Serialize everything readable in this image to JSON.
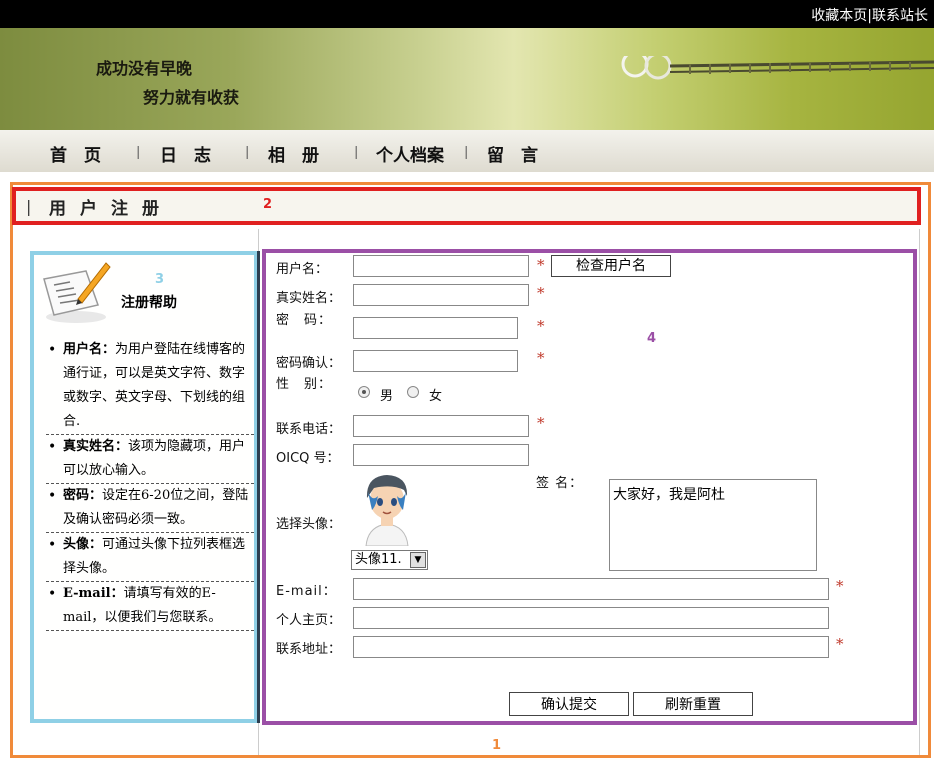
{
  "top_links": {
    "bookmark": "收藏本页",
    "divider": "|",
    "contact": "联系站长"
  },
  "banner": {
    "slogan_line1": "成功没有早晚",
    "slogan_line2": "努力就有收获"
  },
  "nav": {
    "items": [
      "首　页",
      "日　志",
      "相　册",
      "个人档案",
      "留　言"
    ],
    "separator": "|"
  },
  "section": {
    "bar": "|",
    "title": "用户注册"
  },
  "region_numbers": {
    "outer": "1",
    "header": "2",
    "help": "3",
    "form": "4"
  },
  "help": {
    "title": "注册帮助",
    "items": [
      {
        "term": "用户名：",
        "text": "为用户登陆在线博客的通行证，可以是英文字符、数字或数字、英文字母、下划线的组合."
      },
      {
        "term": "真实姓名：",
        "text": "该项为隐藏项，用户可以放心输入。"
      },
      {
        "term": "密码：",
        "text": "设定在6-20位之间，登陆及确认密码必须一致。"
      },
      {
        "term": "头像：",
        "text": "可通过头像下拉列表框选择头像。"
      },
      {
        "term": "E-mail：",
        "text": "请填写有效的E-mail，以便我们与您联系。"
      }
    ]
  },
  "form": {
    "username_label": "用户名：",
    "check_button": "检查用户名",
    "realname_label": "真实姓名：",
    "password_label": "密　码：",
    "confirm_label": "密码确认：",
    "gender_label": "性　别：",
    "gender_male": "男",
    "gender_female": "女",
    "gender_selected": "男",
    "phone_label": "联系电话：",
    "oicq_label": "OICQ 号：",
    "avatar_label": "选择头像：",
    "avatar_selected": "头像11.",
    "signature_label": "签 名：",
    "signature_value": "大家好，我是阿杜",
    "email_label": "E-mail：",
    "homepage_label": "个人主页：",
    "address_label": "联系地址：",
    "required_mark": "*",
    "submit_button": "确认提交",
    "reset_button": "刷新重置"
  },
  "colors": {
    "region_outer": "#f08a3a",
    "region_header": "#e02020",
    "region_help": "#8fd0e6",
    "region_form": "#9b4fa6",
    "required": "#c0392b"
  }
}
